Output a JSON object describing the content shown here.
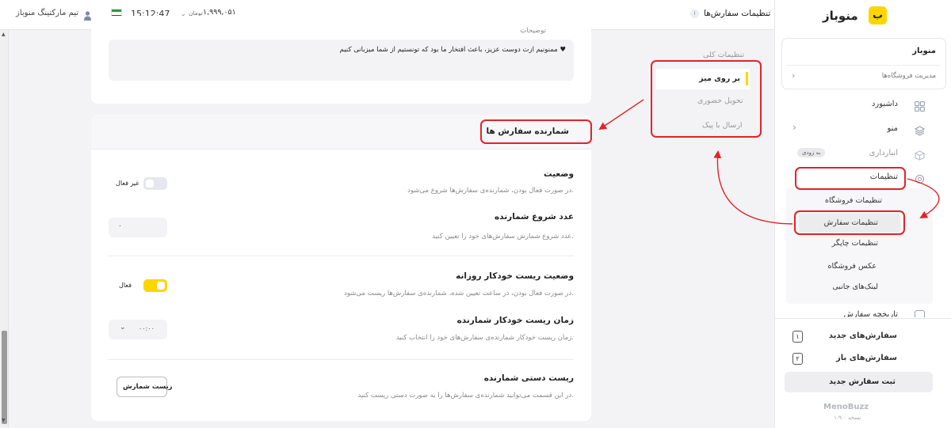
{
  "topbar": {
    "page_title": "تنظیمات سفارش‌ها",
    "team_name": "تیم مارکتینگ منوباز",
    "time": "15:12:47",
    "balance": "۱,۹۹۹,۰۵۱",
    "balance_unit": "تومان"
  },
  "sidebar": {
    "logo_text": "منوباز",
    "logo_badge": "ب",
    "store_name": "منوباز",
    "store_manage": "مدیریت فروشگاه‌ها",
    "nav": {
      "dashboard": "داشبورد",
      "menu": "منو",
      "inventory": "انبارداری",
      "inventory_badge": "به زودی",
      "settings": "تنظیمات",
      "sub_store": "تنظیمات فروشگاه",
      "sub_order": "تنظیمات سفارش",
      "sub_printer": "تنظیمات چاپگر",
      "sub_photo": "عکس فروشگاه",
      "sub_links": "لینک‌های جانبی",
      "history": "تاریخچه سفارش"
    },
    "new_orders": "سفارش‌های جدید",
    "new_orders_count": "۱",
    "open_orders": "سفارش‌های باز",
    "open_orders_count": "۲",
    "new_order_button": "ثبت سفارش جدید",
    "brand": "MenoBuzz",
    "version": "نسخه ۱.۹.۰"
  },
  "settings_tabs": {
    "title": "تنظیمات کلی",
    "items": [
      "بر روی میز",
      "تحویل حضوری",
      "ارسال با پیک"
    ]
  },
  "description_card": {
    "label": "توضیحات",
    "value": "ممنونیم ازت دوست عزیز، باعث افتخار ما بود که تونستیم از شما میزبانی کنیم ♥"
  },
  "counter": {
    "title": "شمارنده سفارش ها",
    "status_label": "وضعیت",
    "status_desc": "در صورت فعال بودن، شمارنده‌ی سفارش‌ها شروع می‌شود.",
    "status_toggle_text": "غیر فعال",
    "status_on": false,
    "start_label": "عدد شروع شمارنده",
    "start_desc": "عدد شروع شمارش سفارش‌های خود را تعیین کنید.",
    "start_value": "۰",
    "reset_status_label": "وضعیت ریست خودکار روزانه",
    "reset_status_desc": "در صورت فعال بودن، در ساعت تعیین شده، شمارنده‌ی سفارش‌ها ریست می‌شود.",
    "reset_toggle_text": "فعال",
    "reset_on": true,
    "reset_time_label": "زمان ریست خودکار شمارنده",
    "reset_time_desc": "زمان ریست خودکار شمارنده‌ی سفارش‌های خود را انتخاب کنید.",
    "reset_time_value": "۰۰:۰۰",
    "manual_label": "ریست دستی شمارنده",
    "manual_desc": "در این قسمت می‌توانید شمارنده‌ی سفارش‌ها را به صورت دستی ریست کنید.",
    "manual_button": "ریست شمارش"
  },
  "colors": {
    "accent": "#ffd500",
    "annotation": "#e3222a"
  }
}
